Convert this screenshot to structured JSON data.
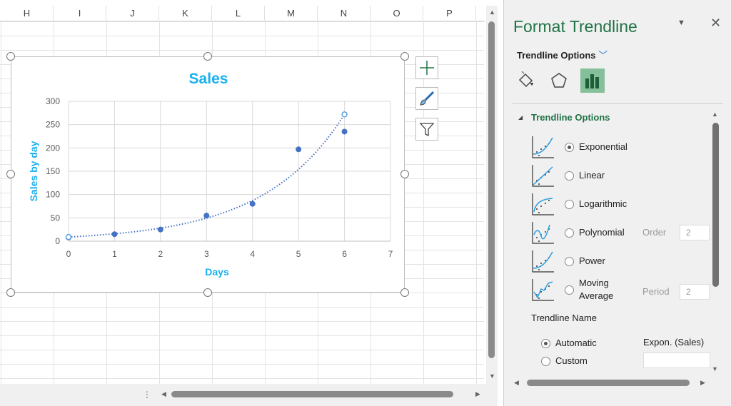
{
  "columns": [
    "H",
    "I",
    "J",
    "K",
    "L",
    "M",
    "N",
    "O",
    "P"
  ],
  "chart_data": {
    "type": "scatter",
    "title": "Sales",
    "xlabel": "Days",
    "ylabel": "Sales by day",
    "xlim": [
      0,
      7
    ],
    "ylim": [
      0,
      300
    ],
    "xticks": [
      "0",
      "1",
      "2",
      "3",
      "4",
      "5",
      "6",
      "7"
    ],
    "yticks": [
      "0",
      "50",
      "100",
      "150",
      "200",
      "250",
      "300"
    ],
    "grid": true,
    "series": [
      {
        "name": "Sales",
        "x": [
          0,
          1,
          2,
          3,
          4,
          5,
          6
        ],
        "y": [
          8,
          15,
          25,
          55,
          80,
          197,
          235
        ],
        "color": "#4472c4"
      }
    ],
    "trendline": {
      "type": "exponential",
      "a": 9,
      "b": 0.568,
      "color": "#4472c4",
      "style": "dotted"
    }
  },
  "panel": {
    "title": "Format Trendline",
    "subtitle": "Trendline Options",
    "section": "Trendline Options",
    "options": [
      {
        "label": "Exponential",
        "selected": true
      },
      {
        "label": "Linear",
        "selected": false
      },
      {
        "label": "Logarithmic",
        "selected": false
      },
      {
        "label": "Polynomial",
        "selected": false
      },
      {
        "label": "Power",
        "selected": false
      },
      {
        "label": "Moving Average",
        "selected": false
      }
    ],
    "order_label": "Order",
    "order_value": "2",
    "period_label": "Period",
    "period_value": "2",
    "name_heading": "Trendline Name",
    "automatic_label": "Automatic",
    "automatic_value": "Expon. (Sales)",
    "custom_label": "Custom",
    "custom_value": ""
  },
  "accent": "#217346"
}
